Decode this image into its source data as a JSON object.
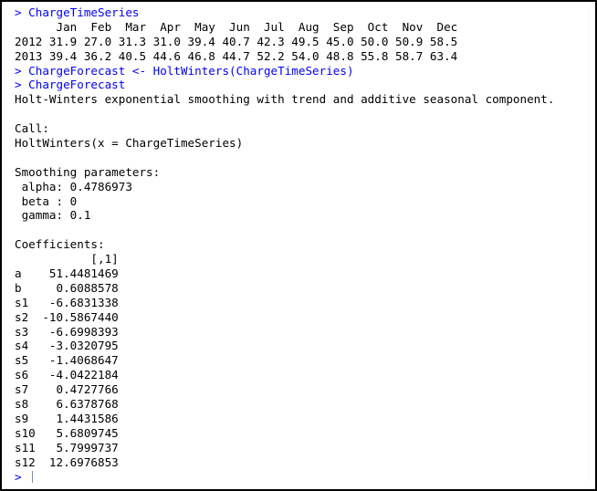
{
  "console": {
    "lines": [
      {
        "kind": "input",
        "text": "> ChargeTimeSeries"
      },
      {
        "kind": "output",
        "text": "      Jan  Feb  Mar  Apr  May  Jun  Jul  Aug  Sep  Oct  Nov  Dec"
      },
      {
        "kind": "output",
        "text": "2012 31.9 27.0 31.3 31.0 39.4 40.7 42.3 49.5 45.0 50.0 50.9 58.5"
      },
      {
        "kind": "output",
        "text": "2013 39.4 36.2 40.5 44.6 46.8 44.7 52.2 54.0 48.8 55.8 58.7 63.4"
      },
      {
        "kind": "input",
        "text": "> ChargeForecast <- HoltWinters(ChargeTimeSeries)"
      },
      {
        "kind": "input",
        "text": "> ChargeForecast"
      },
      {
        "kind": "output",
        "text": "Holt-Winters exponential smoothing with trend and additive seasonal component."
      },
      {
        "kind": "output",
        "text": ""
      },
      {
        "kind": "output",
        "text": "Call:"
      },
      {
        "kind": "output",
        "text": "HoltWinters(x = ChargeTimeSeries)"
      },
      {
        "kind": "output",
        "text": ""
      },
      {
        "kind": "output",
        "text": "Smoothing parameters:"
      },
      {
        "kind": "output",
        "text": " alpha: 0.4786973"
      },
      {
        "kind": "output",
        "text": " beta : 0"
      },
      {
        "kind": "output",
        "text": " gamma: 0.1"
      },
      {
        "kind": "output",
        "text": ""
      },
      {
        "kind": "output",
        "text": "Coefficients:"
      },
      {
        "kind": "output",
        "text": "           [,1]"
      },
      {
        "kind": "output",
        "text": "a    51.4481469"
      },
      {
        "kind": "output",
        "text": "b     0.6088578"
      },
      {
        "kind": "output",
        "text": "s1   -6.6831338"
      },
      {
        "kind": "output",
        "text": "s2  -10.5867440"
      },
      {
        "kind": "output",
        "text": "s3   -6.6998393"
      },
      {
        "kind": "output",
        "text": "s4   -3.0320795"
      },
      {
        "kind": "output",
        "text": "s5   -1.4068647"
      },
      {
        "kind": "output",
        "text": "s6   -4.0422184"
      },
      {
        "kind": "output",
        "text": "s7    0.4727766"
      },
      {
        "kind": "output",
        "text": "s8    6.6378768"
      },
      {
        "kind": "output",
        "text": "s9    1.4431586"
      },
      {
        "kind": "output",
        "text": "s10   5.6809745"
      },
      {
        "kind": "output",
        "text": "s11   5.7999737"
      },
      {
        "kind": "output",
        "text": "s12  12.6976853"
      }
    ],
    "prompt": "> "
  },
  "colors": {
    "input_text": "#0000ff",
    "output_text": "#000000",
    "background": "#ffffff",
    "caret": "#7a8bb5"
  }
}
